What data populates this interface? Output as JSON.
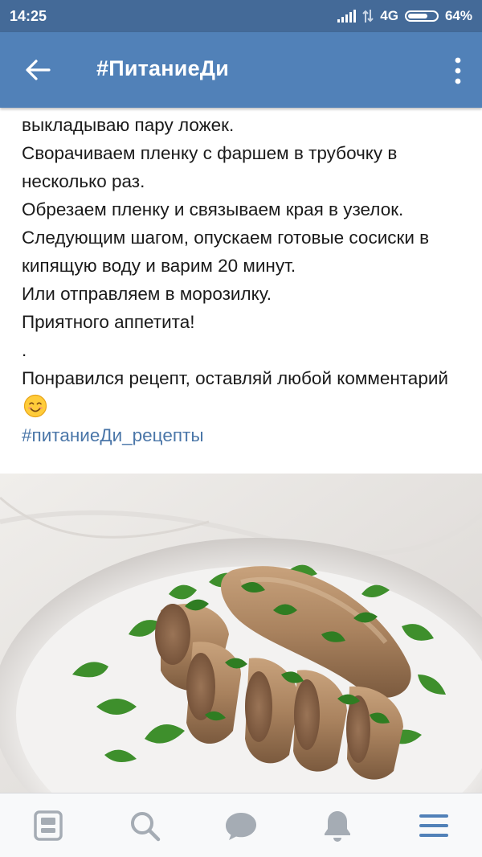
{
  "status_bar": {
    "time": "14:25",
    "network": "4G",
    "battery": "64%",
    "battery_level": 0.64,
    "icons": [
      "signal-icon",
      "mobile-data-icon",
      "battery-icon"
    ]
  },
  "app_bar": {
    "title": "#ПитаниеДи",
    "icons": [
      "back-arrow-icon",
      "more-vertical-icon"
    ]
  },
  "post": {
    "lines": [
      "выкладываю пару ложек.",
      "Сворачиваем пленку с фаршем в трубочку в несколько раз.",
      "Обрезаем пленку и связываем края в узелок.",
      "Следующим шагом, опускаем готовые сосиски в кипящую воду и варим 20 минут.",
      "Или отправляем в морозилку.",
      "Приятного аппетита!",
      ".",
      "Понравился рецепт, оставляй любой комментарий"
    ],
    "hashtag": "#питаниеДи_рецепты",
    "emoji": "smiling-face-emoji",
    "photo": "sausages-with-parsley-photo"
  },
  "bottom_nav": {
    "items": [
      "news-feed-icon",
      "search-icon",
      "messages-icon",
      "notifications-icon",
      "menu-icon"
    ],
    "active": "menu-icon"
  },
  "colors": {
    "status_bar": "#446a98",
    "app_bar": "#5181b8",
    "link": "#4a76a8",
    "nav_icon": "#a5acb4",
    "nav_active": "#5181b8"
  }
}
